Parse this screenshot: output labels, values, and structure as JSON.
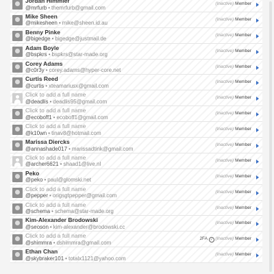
{
  "users": [
    {
      "name": "Jordan Himmler",
      "handle": "@mrfurb",
      "email": "themrfurb@gmail.com",
      "avatar": "photo",
      "placeholder": false,
      "status": "Member",
      "twofa": false
    },
    {
      "name": "Mike Sheen",
      "handle": "@mikesheen",
      "email": "mike@sheen.id.au",
      "avatar": "photo",
      "placeholder": false,
      "status": "Member",
      "twofa": false
    },
    {
      "name": "Benny Pinke",
      "handle": "@bigedge",
      "email": "bigedge@justmail.de",
      "avatar": "photo",
      "placeholder": false,
      "status": "Member",
      "twofa": false
    },
    {
      "name": "Adam Boyle",
      "handle": "@bspkrs",
      "email": "bspkrs@star-made.org",
      "avatar": "photo",
      "placeholder": false,
      "status": "Member",
      "twofa": false
    },
    {
      "name": "Corey Adams",
      "handle": "@c0r3y",
      "email": "corey.adams@hyper-core.net",
      "avatar": "photo",
      "placeholder": false,
      "status": "Member",
      "twofa": false
    },
    {
      "name": "Curtis Reed",
      "handle": "@curtis",
      "email": "xteamariusx@gmail.com",
      "avatar": "photo",
      "placeholder": false,
      "status": "Member",
      "twofa": false
    },
    {
      "name": "Click to add a full name",
      "handle": "@deadlis",
      "email": "deadlis95@gmail.com",
      "avatar": "default",
      "placeholder": true,
      "status": "Member",
      "twofa": false
    },
    {
      "name": "Click to add a full name",
      "handle": "@ecoboff1",
      "email": "ecoboff1@gmail.com",
      "avatar": "photo",
      "placeholder": true,
      "status": "Member",
      "twofa": false
    },
    {
      "name": "Click to add a full name",
      "handle": "@k10wn",
      "email": "tinav8@hotmail.com",
      "avatar": "photo",
      "placeholder": true,
      "status": "Member",
      "twofa": false
    },
    {
      "name": "Marissa Diercks",
      "handle": "@annashade017",
      "email": "marissadtink@gmail.com",
      "avatar": "photo",
      "placeholder": false,
      "status": "Member",
      "twofa": false
    },
    {
      "name": "Click to add a full name",
      "handle": "@archer6621",
      "email": "shaad1@live.nl",
      "avatar": "default",
      "placeholder": true,
      "status": "Member",
      "twofa": false
    },
    {
      "name": "Peko",
      "handle": "@peko",
      "email": "paul@glomski.net",
      "avatar": "photo",
      "placeholder": false,
      "status": "Member",
      "twofa": false
    },
    {
      "name": "Click to add a full name",
      "handle": "@pepper",
      "email": "origsgtpepper@gmail.com",
      "avatar": "photo",
      "placeholder": true,
      "status": "Member",
      "twofa": false
    },
    {
      "name": "Click to add a full name",
      "handle": "@schema",
      "email": "schema@star-made.org",
      "avatar": "photo",
      "placeholder": true,
      "status": "Member",
      "twofa": false
    },
    {
      "name": "Kim-Alexander Brodowski",
      "handle": "@seoson",
      "email": "kim-alexander@brodowski.cc",
      "avatar": "photo",
      "placeholder": false,
      "status": "Member",
      "twofa": false
    },
    {
      "name": "Click to add a full name",
      "handle": "@shimmra",
      "email": "dshimmra@gmail.com",
      "avatar": "photo",
      "placeholder": true,
      "status": "Member",
      "twofa": true
    },
    {
      "name": "Ethan Chan",
      "handle": "@skybraker101",
      "email": "totalx1121@yahoo.com",
      "avatar": "photo",
      "placeholder": false,
      "status": "Member",
      "twofa": false
    }
  ],
  "labels": {
    "inactive": "(Inactive)",
    "twofa": "2FA",
    "separator": "•"
  },
  "colors": {
    "accent": "#3a6fc4",
    "name": "#333333",
    "placeholder": "#9a9a9a",
    "email": "#8a8a8a"
  }
}
